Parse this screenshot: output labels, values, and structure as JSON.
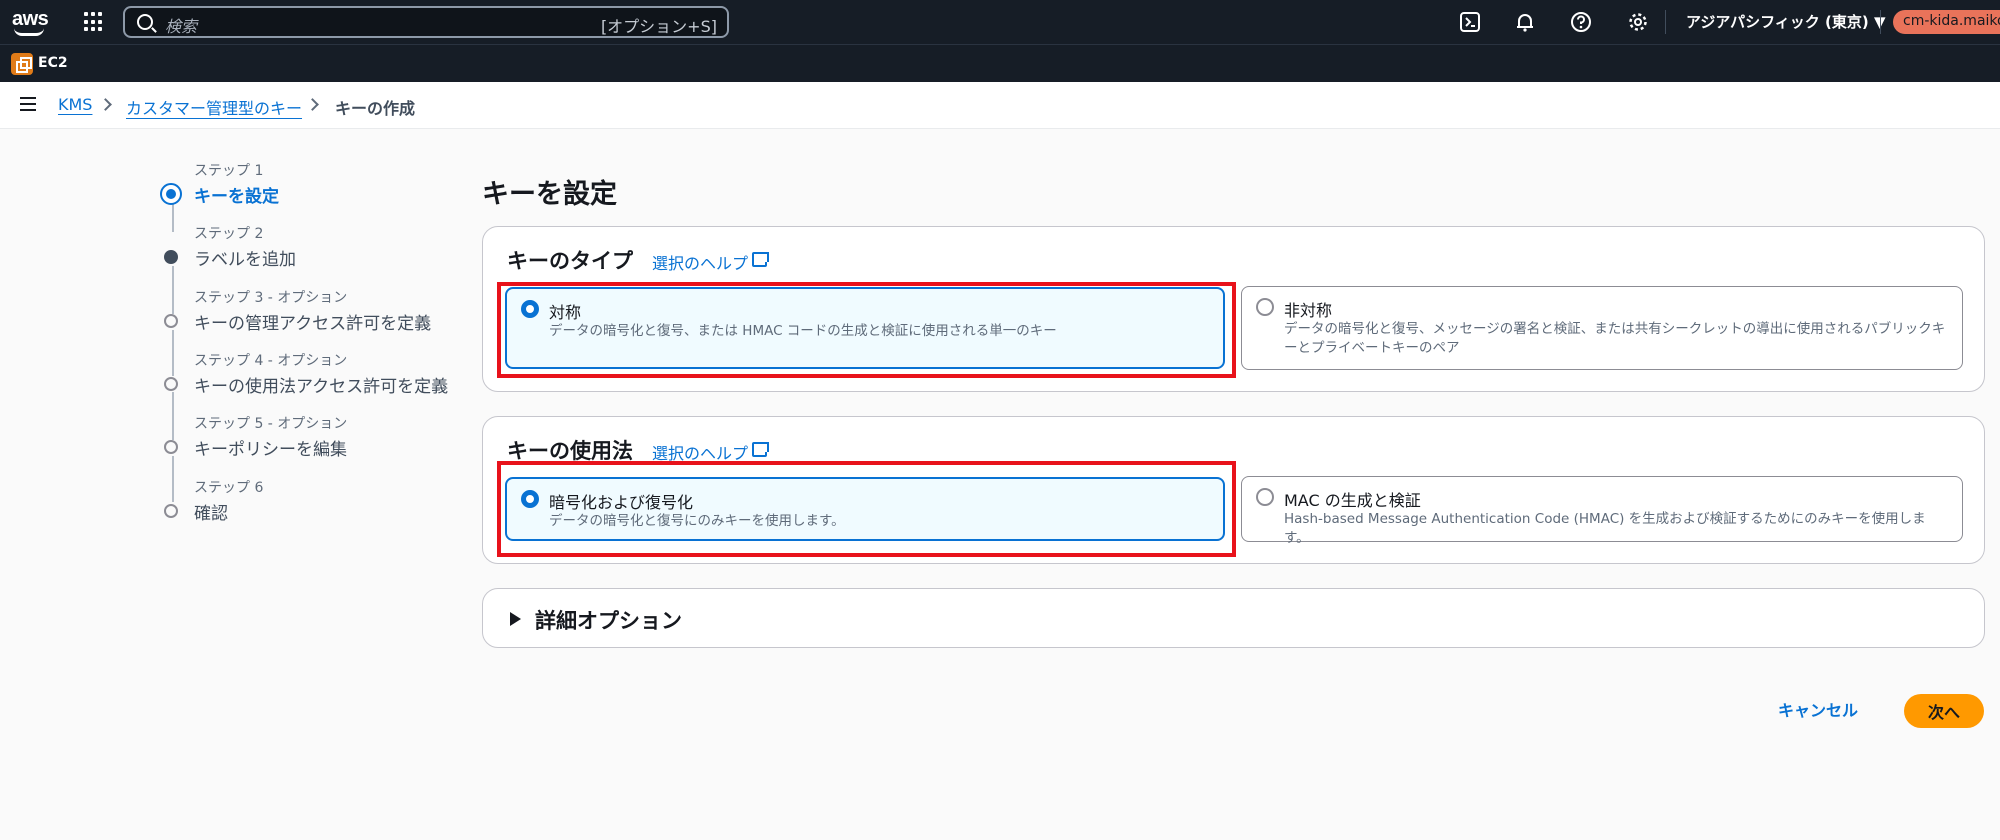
{
  "topnav": {
    "logo_text": "aws",
    "search_placeholder": "検索",
    "search_shortcut": "[オプション+S]",
    "region": "アジアパシフィック (東京) ▼",
    "account": "cm-kida.maiko+"
  },
  "servicebar": {
    "label": "EC2"
  },
  "breadcrumb": {
    "items": [
      "KMS",
      "カスタマー管理型のキー",
      "キーの作成"
    ]
  },
  "steps": [
    {
      "sub": "ステップ 1",
      "title": "キーを設定"
    },
    {
      "sub": "ステップ 2",
      "title": "ラベルを追加"
    },
    {
      "sub": "ステップ 3 - オプション",
      "title": "キーの管理アクセス許可を定義"
    },
    {
      "sub": "ステップ 4 - オプション",
      "title": "キーの使用法アクセス許可を定義"
    },
    {
      "sub": "ステップ 5 - オプション",
      "title": "キーポリシーを編集"
    },
    {
      "sub": "ステップ 6",
      "title": "確認"
    }
  ],
  "page": {
    "title": "キーを設定"
  },
  "key_type": {
    "heading": "キーのタイプ",
    "help": "選択のヘルプ",
    "options": [
      {
        "title": "対称",
        "desc": "データの暗号化と復号、または HMAC コードの生成と検証に使用される単一のキー"
      },
      {
        "title": "非対称",
        "desc": "データの暗号化と復号、メッセージの署名と検証、または共有シークレットの導出に使用されるパブリックキーとプライベートキーのペア"
      }
    ]
  },
  "key_usage": {
    "heading": "キーの使用法",
    "help": "選択のヘルプ",
    "options": [
      {
        "title": "暗号化および復号化",
        "desc": "データの暗号化と復号にのみキーを使用します。"
      },
      {
        "title": "MAC の生成と検証",
        "desc": "Hash-based Message Authentication Code (HMAC) を生成および検証するためにのみキーを使用します。"
      }
    ]
  },
  "advanced": {
    "label": "詳細オプション"
  },
  "actions": {
    "cancel": "キャンセル",
    "next": "次へ"
  },
  "colors": {
    "accent": "#0972d3",
    "primary_button": "#ff9900",
    "highlight": "#e8121b",
    "nav_bg": "#161d26"
  }
}
